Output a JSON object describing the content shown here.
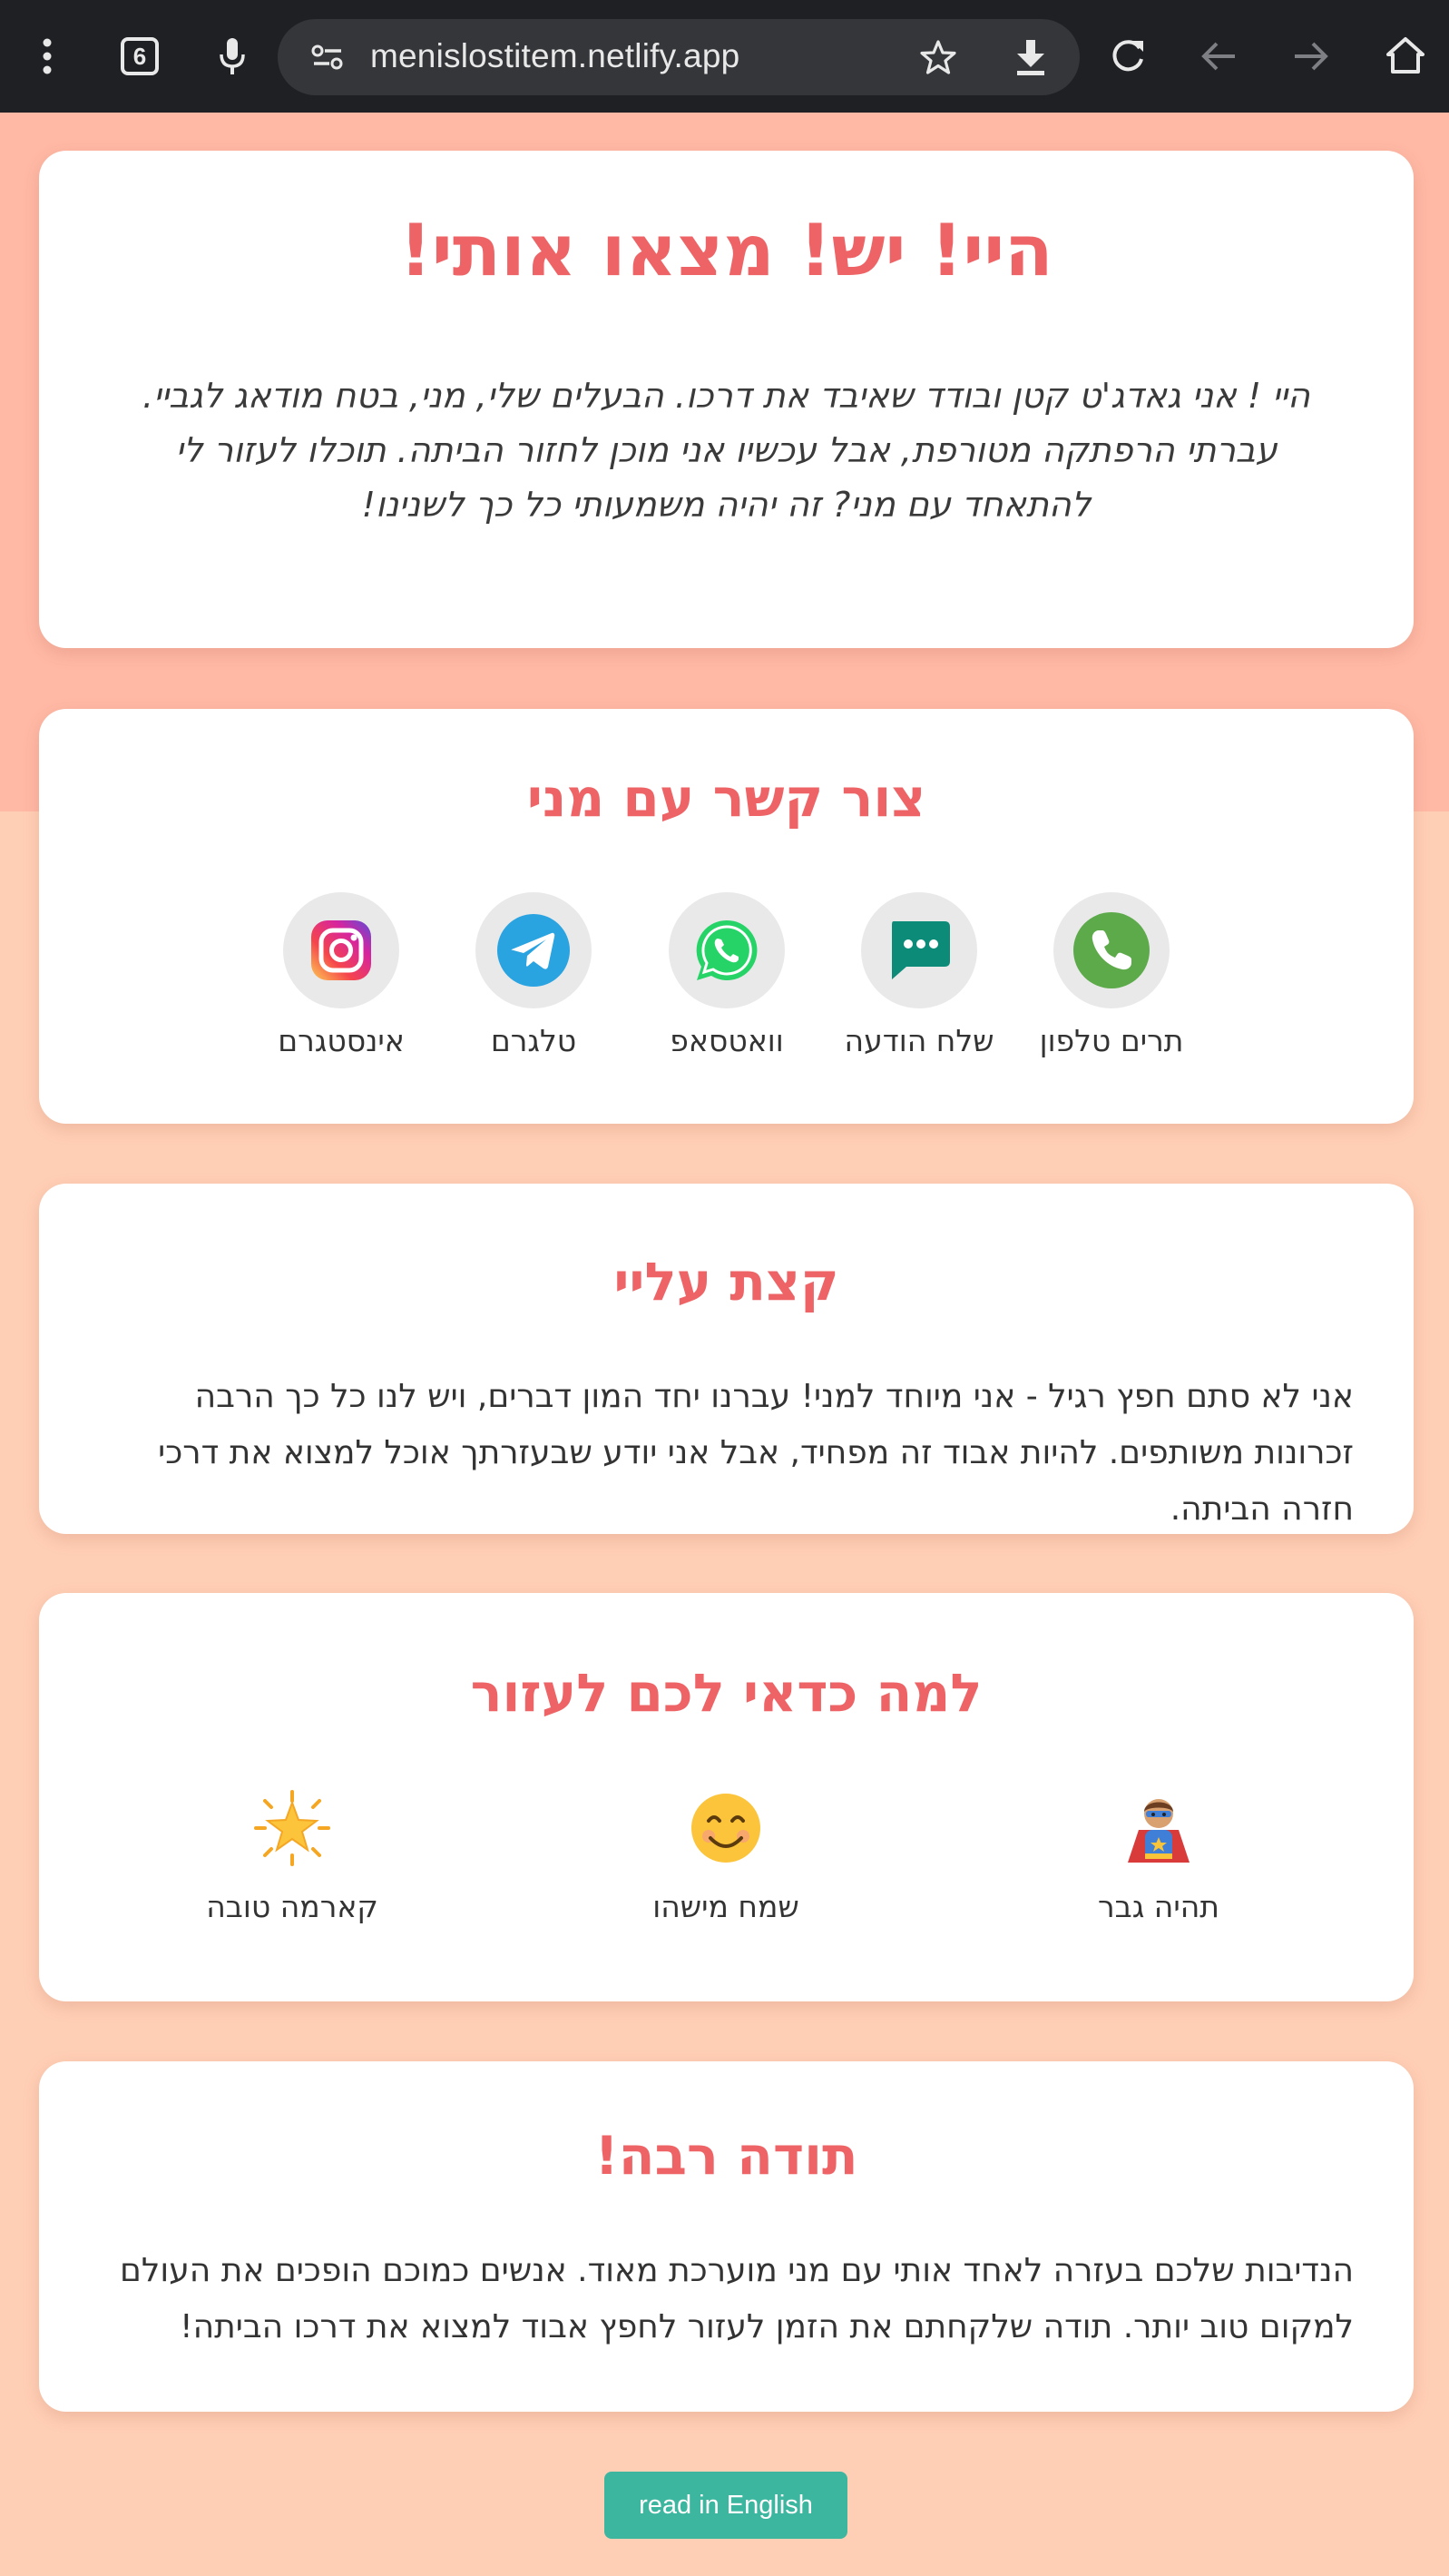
{
  "browser": {
    "url": "menislostitem.netlify.app",
    "tab_count": "6",
    "icons": [
      "menu-icon",
      "tabs-icon",
      "microphone-icon",
      "site-info-icon",
      "star-icon",
      "download-icon",
      "reload-icon",
      "back-icon",
      "forward-icon",
      "home-icon"
    ]
  },
  "hero": {
    "title": "היי! יש! מצאו אותי!",
    "intro": "היי ! אני גאדג'ט קטן ובודד שאיבד את דרכו. הבעלים שלי, מני, בטח מודאג לגביי. עברתי הרפתקה מטורפת, אבל עכשיו אני מוכן לחזור הביתה. תוכלו לעזור לי להתאחד עם מני? זה יהיה משמעותי כל כך לשנינו!"
  },
  "contact": {
    "title": "צור קשר עם מני",
    "items": [
      {
        "label": "תרים טלפון",
        "icon": "phone-icon",
        "color": "#5DAA4B"
      },
      {
        "label": "שלח הודעה",
        "icon": "message-icon",
        "color": "#0D8B79"
      },
      {
        "label": "וואטסאפ",
        "icon": "whatsapp-icon",
        "color": "#25D366"
      },
      {
        "label": "טלגרם",
        "icon": "telegram-icon",
        "color": "#2AA3E1"
      },
      {
        "label": "אינסטגרם",
        "icon": "instagram-icon",
        "color": "#D6249F"
      }
    ]
  },
  "about": {
    "title": "קצת עליי",
    "body": "אני לא סתם חפץ רגיל - אני מיוחד למני! עברנו יחד המון דברים, ויש לנו כל כך הרבה זכרונות משותפים. להיות אבוד זה מפחיד, אבל אני יודע שבעזרתך אוכל למצוא את דרכי חזרה הביתה."
  },
  "why": {
    "title": "למה כדאי לכם לעזור",
    "items": [
      {
        "label": "תהיה גבר",
        "icon": "superhero-icon"
      },
      {
        "label": "שמח מישהו",
        "icon": "smiling-face-icon"
      },
      {
        "label": "קארמה טובה",
        "icon": "glowing-star-icon"
      }
    ]
  },
  "thanks": {
    "title": "תודה רבה!",
    "body": "הנדיבות שלכם בעזרה לאחד אותי עם מני מוערכת מאוד. אנשים כמוכם הופכים את העולם למקום טוב יותר. תודה שלקחתם את הזמן לעזור לחפץ אבוד למצוא את דרכו הביתה!"
  },
  "footer": {
    "language_button": "read in English"
  },
  "colors": {
    "accent": "#EE6466",
    "top_background": "#FFB9A5",
    "page_background": "#FFCFB5",
    "button": "#3DB6A0"
  }
}
